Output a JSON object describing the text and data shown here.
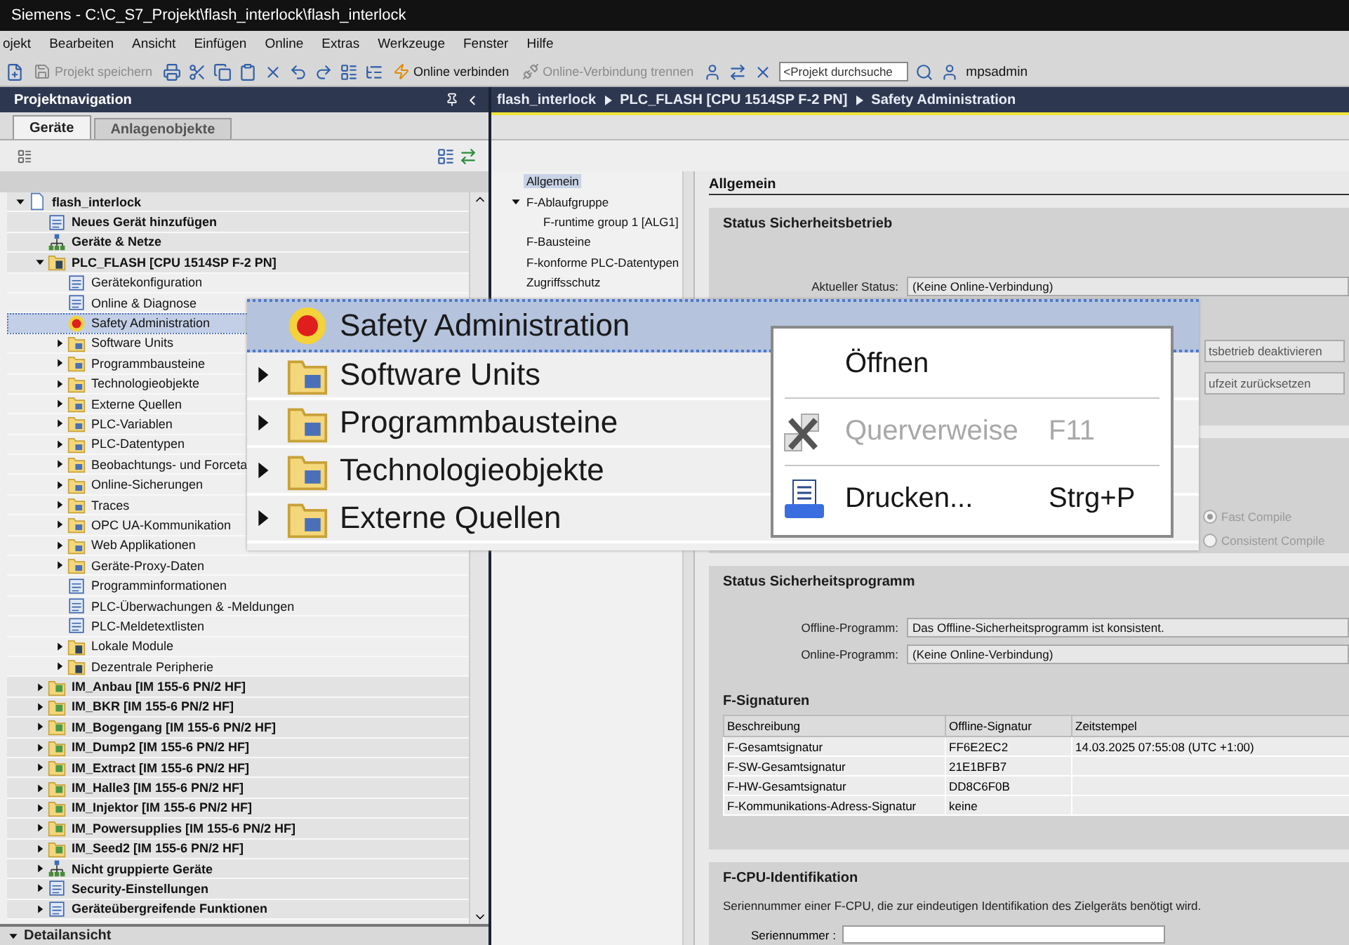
{
  "window": {
    "title": "Siemens - C:\\C_S7_Projekt\\flash_interlock\\flash_interlock"
  },
  "menu": [
    "ojekt",
    "Bearbeiten",
    "Ansicht",
    "Einfügen",
    "Online",
    "Extras",
    "Werkzeuge",
    "Fenster",
    "Hilfe"
  ],
  "toolbar": {
    "save": {
      "label": "Projekt speichern",
      "disabled": true
    },
    "connect": {
      "label": "Online verbinden",
      "disabled": false
    },
    "disconnect": {
      "label": "Online-Verbindung trennen",
      "disabled": true
    },
    "search": {
      "placeholder": "<Projekt durchsuche"
    },
    "user": "mpsadmin"
  },
  "navigation": {
    "title": "Projektnavigation",
    "tabs": [
      {
        "label": "Geräte",
        "selected": true
      },
      {
        "label": "Anlagenobjekte",
        "selected": false
      }
    ],
    "tree": [
      {
        "label": "flash_interlock",
        "kind": "project",
        "expanded": true,
        "selected": false,
        "children": [
          {
            "label": "Neues Gerät hinzufügen",
            "kind": "item",
            "selected": false
          },
          {
            "label": "Geräte & Netze",
            "kind": "network",
            "selected": false
          },
          {
            "label": "PLC_FLASH [CPU 1514SP F-2 PN]",
            "kind": "plc",
            "expanded": true,
            "selected": false,
            "children": [
              {
                "label": "Gerätekonfiguration",
                "kind": "item",
                "selected": false
              },
              {
                "label": "Online & Diagnose",
                "kind": "item",
                "selected": false
              },
              {
                "label": "Safety Administration",
                "kind": "safety",
                "selected": true
              },
              {
                "label": "Software Units",
                "kind": "folder",
                "expanded": false,
                "selected": false
              },
              {
                "label": "Programmbausteine",
                "kind": "folder",
                "expanded": false,
                "selected": false
              },
              {
                "label": "Technologieobjekte",
                "kind": "folder",
                "expanded": false,
                "selected": false
              },
              {
                "label": "Externe Quellen",
                "kind": "folder",
                "expanded": false,
                "selected": false
              },
              {
                "label": "PLC-Variablen",
                "kind": "folder",
                "expanded": false,
                "selected": false
              },
              {
                "label": "PLC-Datentypen",
                "kind": "folder",
                "expanded": false,
                "selected": false
              },
              {
                "label": "Beobachtungs- und Forceta",
                "kind": "folder",
                "expanded": false,
                "selected": false
              },
              {
                "label": "Online-Sicherungen",
                "kind": "folder",
                "expanded": false,
                "selected": false
              },
              {
                "label": "Traces",
                "kind": "folder",
                "expanded": false,
                "selected": false
              },
              {
                "label": "OPC UA-Kommunikation",
                "kind": "folder",
                "expanded": false,
                "selected": false
              },
              {
                "label": "Web Applikationen",
                "kind": "folder",
                "expanded": false,
                "selected": false
              },
              {
                "label": "Geräte-Proxy-Daten",
                "kind": "folder",
                "expanded": false,
                "selected": false
              },
              {
                "label": "Programminformationen",
                "kind": "item",
                "selected": false
              },
              {
                "label": "PLC-Überwachungen & -Meldungen",
                "kind": "item",
                "selected": false
              },
              {
                "label": "PLC-Meldetextlisten",
                "kind": "item",
                "selected": false
              },
              {
                "label": "Lokale Module",
                "kind": "plc",
                "expanded": false,
                "selected": false
              },
              {
                "label": "Dezentrale Peripherie",
                "kind": "plc",
                "expanded": false,
                "selected": false
              }
            ]
          },
          {
            "label": "IM_Anbau [IM 155-6 PN/2 HF]",
            "kind": "device",
            "expanded": false,
            "selected": false
          },
          {
            "label": "IM_BKR [IM 155-6 PN/2 HF]",
            "kind": "device",
            "expanded": false,
            "selected": false
          },
          {
            "label": "IM_Bogengang [IM 155-6 PN/2 HF]",
            "kind": "device",
            "expanded": false,
            "selected": false
          },
          {
            "label": "IM_Dump2 [IM 155-6 PN/2 HF]",
            "kind": "device",
            "expanded": false,
            "selected": false
          },
          {
            "label": "IM_Extract [IM 155-6 PN/2 HF]",
            "kind": "device",
            "expanded": false,
            "selected": false
          },
          {
            "label": "IM_Halle3 [IM 155-6 PN/2 HF]",
            "kind": "device",
            "expanded": false,
            "selected": false
          },
          {
            "label": "IM_Injektor [IM 155-6 PN/2 HF]",
            "kind": "device",
            "expanded": false,
            "selected": false
          },
          {
            "label": "IM_Powersupplies [IM 155-6 PN/2 HF]",
            "kind": "device",
            "expanded": false,
            "selected": false
          },
          {
            "label": "IM_Seed2 [IM 155-6 PN/2 HF]",
            "kind": "device",
            "expanded": false,
            "selected": false
          },
          {
            "label": "Nicht gruppierte Geräte",
            "kind": "network",
            "expanded": false,
            "selected": false
          },
          {
            "label": "Security-Einstellungen",
            "kind": "item",
            "expanded": false,
            "selected": false
          },
          {
            "label": "Geräteübergreifende Funktionen",
            "kind": "item",
            "expanded": false,
            "selected": false
          }
        ]
      }
    ],
    "detail": {
      "title": "Detailansicht",
      "expanded": true
    }
  },
  "breadcrumb": [
    "flash_interlock",
    "PLC_FLASH [CPU 1514SP F-2 PN]",
    "Safety Administration"
  ],
  "sections_nav": [
    {
      "label": "Allgemein",
      "selected": true
    },
    {
      "label": "F-Ablaufgruppe",
      "selected": false,
      "expanded": true,
      "children": [
        {
          "label": "F-runtime group 1 [ALG1]",
          "selected": false
        }
      ]
    },
    {
      "label": "F-Bausteine",
      "selected": false
    },
    {
      "label": "F-konforme PLC-Datentypen",
      "selected": false
    },
    {
      "label": "Zugriffsschutz",
      "selected": false
    }
  ],
  "content": {
    "heading": "Allgemein",
    "safety_mode": {
      "title": "Status Sicherheitsbetrieb",
      "status_label": "Aktueller Status:",
      "status_value": "(Keine Online-Verbindung)",
      "buttons": [
        "tsbetrieb deaktivieren",
        "ufzeit zurücksetzen"
      ]
    },
    "compile": {
      "disabled": true,
      "options": [
        {
          "label": "Fast Compile",
          "selected": true
        },
        {
          "label": "Consistent Compile",
          "selected": false
        }
      ]
    },
    "program": {
      "title": "Status Sicherheitsprogramm",
      "fields": [
        {
          "label": "Offline-Programm:",
          "value": "Das Offline-Sicherheitsprogramm ist konsistent."
        },
        {
          "label": "Online-Programm:",
          "value": "(Keine Online-Verbindung)"
        }
      ],
      "signatures": {
        "title": "F-Signaturen",
        "columns": [
          "Beschreibung",
          "Offline-Signatur",
          "Zeitstempel"
        ],
        "rows": [
          [
            "F-Gesamtsignatur",
            "FF6E2EC2",
            "14.03.2025 07:55:08 (UTC +1:00)"
          ],
          [
            "F-SW-Gesamtsignatur",
            "21E1BFB7"
          ],
          [
            "F-HW-Gesamtsignatur",
            "DD8C6F0B"
          ],
          [
            "F-Kommunikations-Adress-Signatur",
            "keine"
          ]
        ]
      }
    },
    "identification": {
      "title": "F-CPU-Identifikation",
      "description": "Seriennummer einer F-CPU, die zur eindeutigen Identifikation des Zielgeräts benötigt wird.",
      "serial_label": "Seriennummer :"
    }
  },
  "magnifier": {
    "rows": [
      {
        "label": "Safety Administration",
        "kind": "safety",
        "selected": true
      },
      {
        "label": "Software Units",
        "kind": "folder",
        "selected": false,
        "expanded": false
      },
      {
        "label": "Programmbausteine",
        "kind": "folder",
        "selected": false,
        "expanded": false
      },
      {
        "label": "Technologieobjekte",
        "kind": "folder",
        "selected": false,
        "expanded": false
      },
      {
        "label": "Externe Quellen",
        "kind": "folder",
        "selected": false,
        "expanded": false
      }
    ]
  },
  "context_menu": {
    "items": [
      {
        "label": "Öffnen",
        "kind": "plain",
        "disabled": false
      },
      {
        "label": "Querverweise",
        "shortcut": "F11",
        "kind": "crossref",
        "disabled": true
      },
      {
        "label": "Drucken...",
        "shortcut": "Strg+P",
        "kind": "print",
        "disabled": false
      }
    ]
  }
}
